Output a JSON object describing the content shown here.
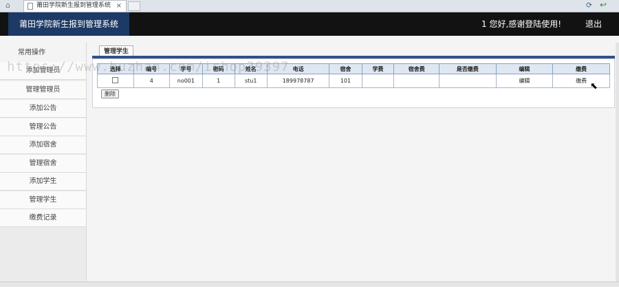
{
  "browser": {
    "tab_title": "莆田学院新生报到管理系统",
    "tab_close": "×",
    "home_icon": "home-icon",
    "refresh_icon": "refresh-icon",
    "back_icon": "back-arrow-icon"
  },
  "header": {
    "title": "莆田学院新生报到管理系统",
    "welcome": "1 您好,感谢登陆使用!",
    "logout": "退出"
  },
  "sidebar": {
    "heading": "常用操作",
    "items": [
      {
        "label": "添加管理员"
      },
      {
        "label": "管理管理员"
      },
      {
        "label": "添加公告"
      },
      {
        "label": "管理公告"
      },
      {
        "label": "添加宿舍"
      },
      {
        "label": "管理宿舍"
      },
      {
        "label": "添加学生"
      },
      {
        "label": "管理学生"
      },
      {
        "label": "缴费记录"
      }
    ]
  },
  "main": {
    "tab_label": "管理学生",
    "table": {
      "headers": [
        "选择",
        "编号",
        "学号",
        "密码",
        "姓名",
        "电话",
        "宿舍",
        "学费",
        "宿舍费",
        "是否缴费",
        "编辑",
        "缴费"
      ],
      "rows": [
        {
          "id": "4",
          "student_no": "no001",
          "password": "1",
          "name": "stu1",
          "phone": "189978787",
          "dorm": "101",
          "tuition": "",
          "dorm_fee": "",
          "paid": "",
          "edit": "编辑",
          "pay": "缴费"
        }
      ]
    },
    "delete_button": "删除"
  },
  "watermark": "https://www.huzhan.com/ishop39397",
  "colors": {
    "header_bg": "#121212",
    "title_bg": "#1d3a66",
    "panel_line": "#33508a"
  }
}
